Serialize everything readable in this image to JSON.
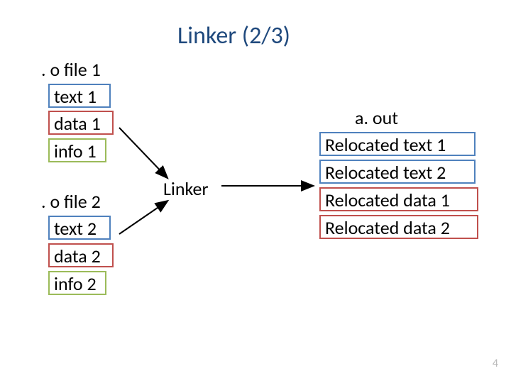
{
  "slide": {
    "title": "Linker (2/3)",
    "page_number": "4"
  },
  "file1": {
    "name": ". o file 1",
    "text": "text 1",
    "data": "data 1",
    "info": "info 1"
  },
  "file2": {
    "name": ". o file 2",
    "text": "text 2",
    "data": "data 2",
    "info": "info 2"
  },
  "linker": {
    "label": "Linker"
  },
  "output": {
    "name": "a. out",
    "rtext1": "Relocated text 1",
    "rtext2": "Relocated text 2",
    "rdata1": "Relocated data 1",
    "rdata2": "Relocated data 2"
  }
}
